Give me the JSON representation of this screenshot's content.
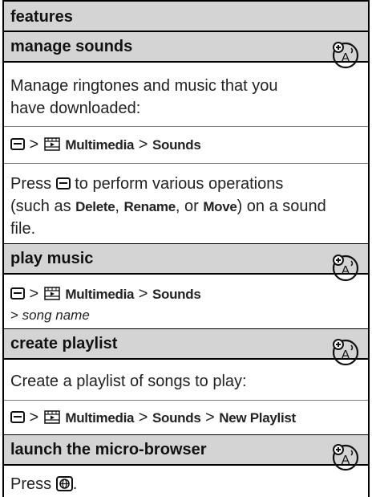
{
  "table_header": "features",
  "sections": [
    {
      "title": "manage sounds",
      "description": "Manage ringtones and music that you have downloaded:",
      "desc_line1": "Manage ringtones and music that you",
      "desc_line2": "have downloaded:",
      "path": {
        "menu_key_icon": "menu-key-icon",
        "sep1": " > ",
        "multimedia_icon": "multimedia-icon",
        "item1": "Multimedia",
        "sep2": " > ",
        "item2": "Sounds"
      },
      "press": {
        "line1_pre": "Press ",
        "line1_post": " to perform various operations",
        "line2_pre": "(such as ",
        "delete": "Delete",
        "comma1": ", ",
        "rename": "Rename",
        "or": ", or ",
        "move": "Move",
        "line2_post": ") on a sound",
        "line3": "file."
      },
      "icon": "network-feature-icon"
    },
    {
      "title": "play music",
      "path": {
        "sep1": " > ",
        "item1": "Multimedia",
        "sep2": " > ",
        "item2": "Sounds",
        "line2_sep": "> ",
        "line2_item": "song name"
      },
      "icon": "network-feature-icon"
    },
    {
      "title": "create playlist",
      "description": "Create a playlist of songs to play:",
      "path": {
        "sep1": " > ",
        "item1": "Multimedia",
        "sep2": " > ",
        "item2": "Sounds",
        "sep3": " > ",
        "item3": "New Playlist"
      },
      "icon": "network-feature-icon"
    },
    {
      "title": "launch the micro-browser",
      "press_pre": "Press ",
      "press_post": ".",
      "icon": "network-feature-icon"
    }
  ]
}
